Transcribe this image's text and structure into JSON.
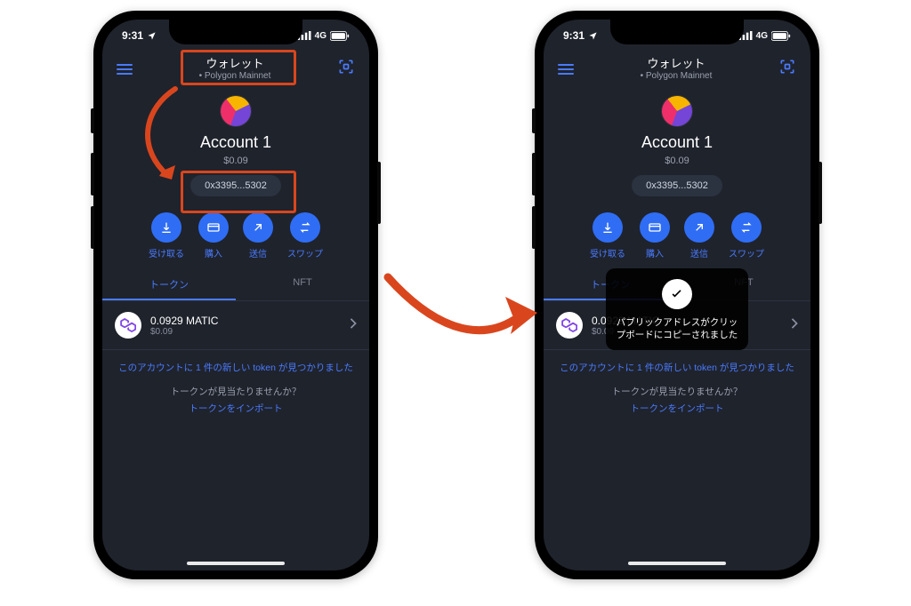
{
  "status": {
    "time": "9:31",
    "carrier": "4G"
  },
  "header": {
    "title": "ウォレット",
    "network": "Polygon Mainnet"
  },
  "account": {
    "name": "Account 1",
    "balance": "$0.09",
    "address_short": "0x3395...5302"
  },
  "actions": {
    "receive": "受け取る",
    "buy": "購入",
    "send": "送信",
    "swap": "スワップ"
  },
  "tabs": {
    "tokens": "トークン",
    "nft": "NFT"
  },
  "token": {
    "name": "0.0929 MATIC",
    "fiat": "$0.09"
  },
  "messages": {
    "found": "このアカウントに 1 件の新しい token が見つかりました",
    "not_found_q": "トークンが見当たりませんか？",
    "import": "トークンをインポート"
  },
  "toast": {
    "message": "パブリックアドレスがクリップボードにコピーされました"
  }
}
